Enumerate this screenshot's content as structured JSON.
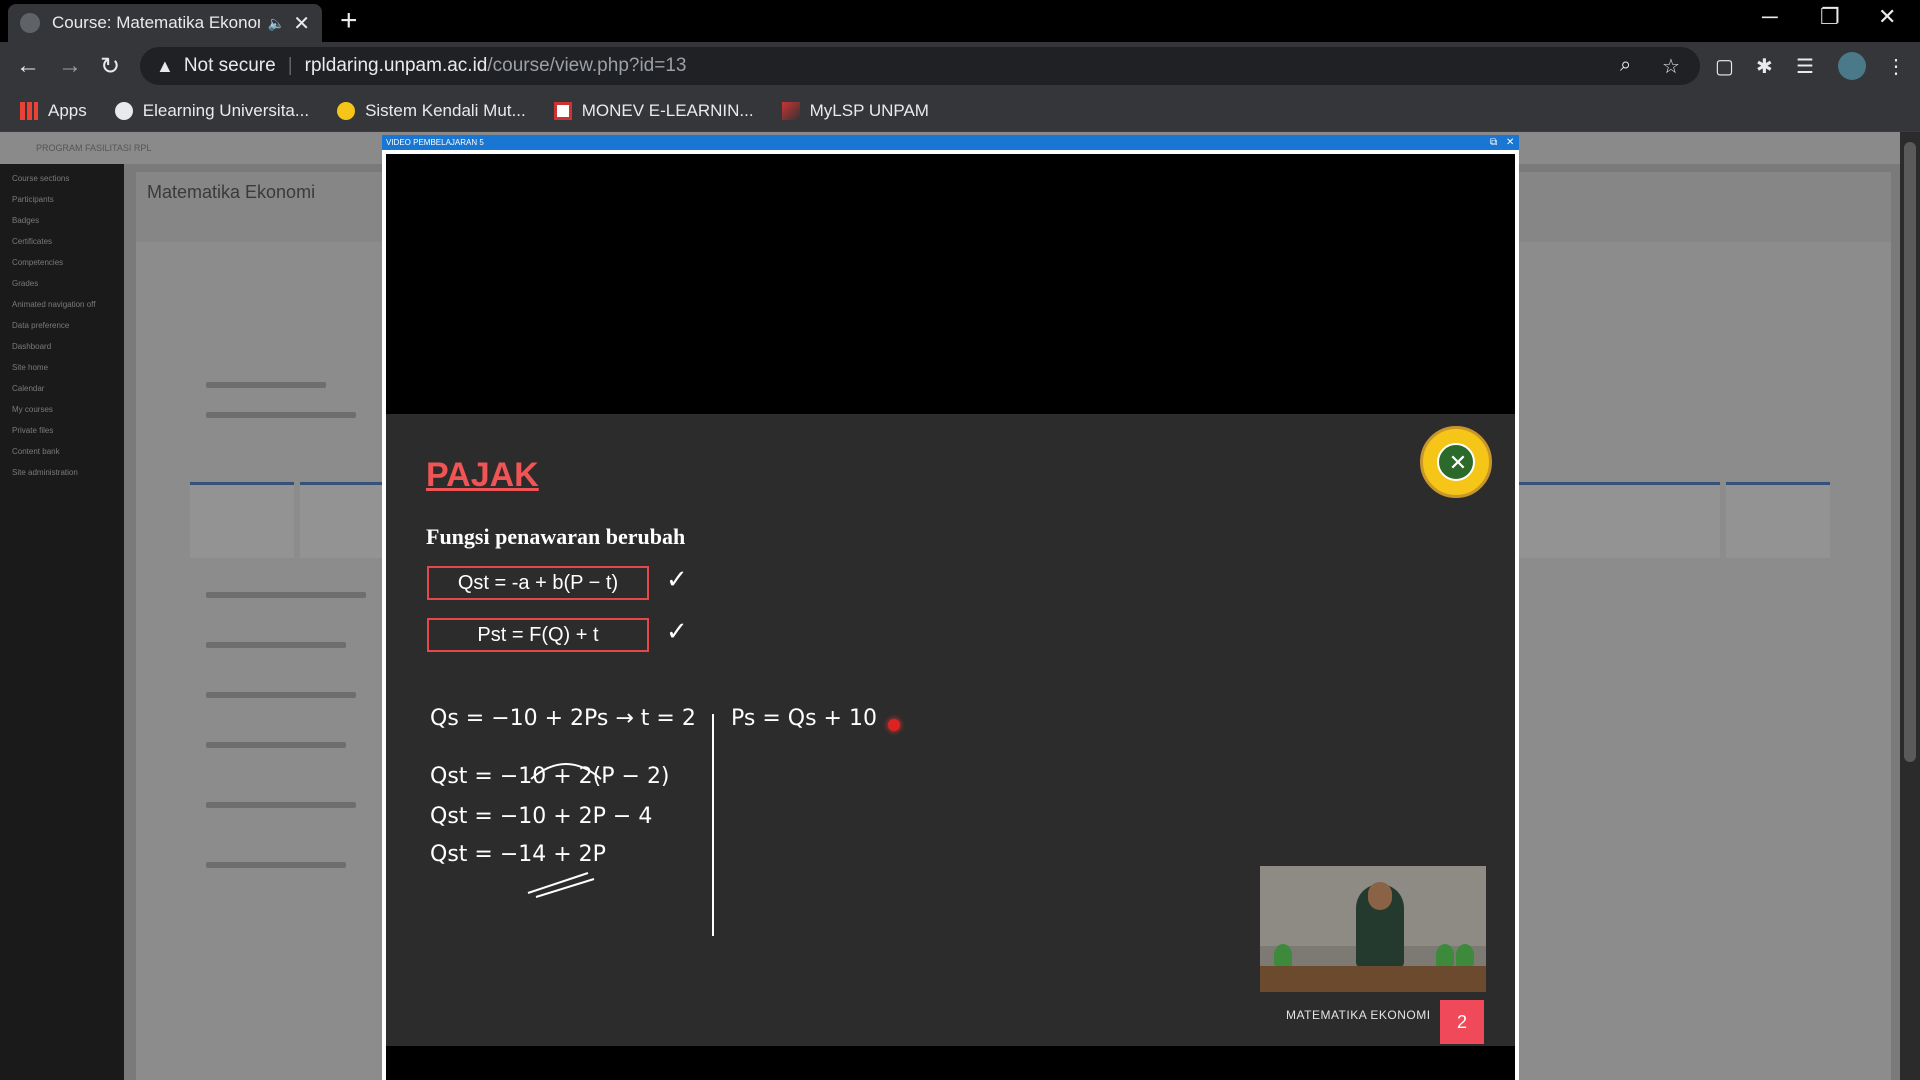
{
  "browser": {
    "tab_title": "Course: Matematika Ekonom",
    "security_label": "Not secure",
    "url_host": "rpldaring.unpam.ac.id",
    "url_path": "/course/view.php?id=13"
  },
  "bookmarks": [
    {
      "label": "Apps",
      "icon": "apps-grid-icon"
    },
    {
      "label": "Elearning Universita...",
      "icon": "globe-icon"
    },
    {
      "label": "Sistem Kendali Mut...",
      "icon": "badge-icon"
    },
    {
      "label": "MONEV E-LEARNIN...",
      "icon": "doc-icon"
    },
    {
      "label": "MyLSP UNPAM",
      "icon": "flag-icon"
    }
  ],
  "lms": {
    "topbar_label": "PROGRAM FASILITASI RPL",
    "course_title": "Matematika Ekonomi",
    "sidebar": [
      "Course sections",
      "Participants",
      "Badges",
      "Certificates",
      "Competencies",
      "Grades",
      "Animated navigation off",
      "Data preference",
      "Dashboard",
      "Site home",
      "Calendar",
      "My courses",
      "Private files",
      "Content bank",
      "Site administration"
    ]
  },
  "popup": {
    "header": "VIDEO PEMBELAJARAN 5"
  },
  "slide": {
    "title": "PAJAK",
    "subtitle": "Fungsi penawaran berubah",
    "formula1": "Qst = -a + b(P − t)",
    "formula2": "Pst = F(Q) + t",
    "work": [
      "Qs = −10 + 2Ps  → t = 2",
      "Qst = −10 + 2(P − 2)",
      "Qst = −10 + 2P − 4",
      "Qst = −14 + 2P"
    ],
    "side_note": "Ps = Qs + 10",
    "footer": "MATEMATIKA EKONOMI",
    "page": "2"
  },
  "colors": {
    "accent_red": "#f05454",
    "popup_blue": "#1976d2"
  }
}
